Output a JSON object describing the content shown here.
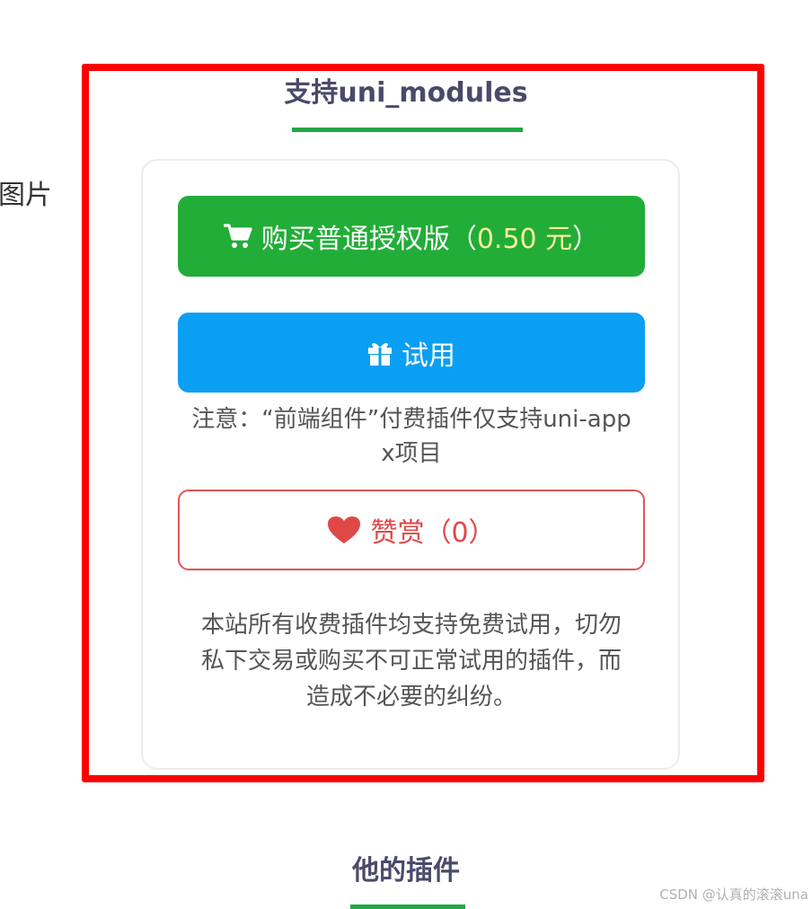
{
  "left_fragment": "图片",
  "section_top": {
    "title": "支持uni_modules"
  },
  "buttons": {
    "buy": {
      "label": "购买普通授权版（",
      "price": "0.50 元",
      "close": "）",
      "icon": "cart-icon"
    },
    "trial": {
      "label": "试用",
      "icon": "gift-icon"
    },
    "reward": {
      "label": "赞赏（0）",
      "icon": "heart-icon"
    }
  },
  "note": {
    "line1": "注意：“前端组件”付费插件仅支持uni-app",
    "line2": "x项目"
  },
  "disclaimer": {
    "line1": "本站所有收费插件均支持免费试用，切勿",
    "line2": "私下交易或购买不可正常试用的插件，而",
    "line3": "造成不必要的纠纷。"
  },
  "section_bottom": {
    "title": "他的插件"
  },
  "watermark": "CSDN @认真的滚滚una",
  "colors": {
    "buy": "#22ad38",
    "trial": "#0a9ff2",
    "reward": "#e04848",
    "price": "#f4ef9a",
    "frame": "#ff0000",
    "underline": "#20a848"
  }
}
